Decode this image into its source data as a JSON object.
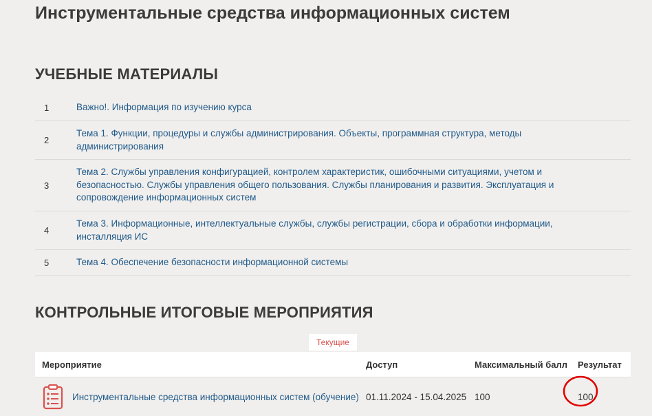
{
  "course": {
    "title": "Инструментальные средства информационных систем"
  },
  "materials": {
    "heading": "УЧЕБНЫЕ МАТЕРИАЛЫ",
    "items": [
      {
        "num": "1",
        "label": "Важно!. Информация по изучению курса"
      },
      {
        "num": "2",
        "label": "Тема 1. Функции, процедуры и службы администрирования. Объекты, программная структура, методы администрирования"
      },
      {
        "num": "3",
        "label": "Тема 2. Службы управления конфигурацией, контролем характеристик, ошибочными ситуациями, учетом и безопасностью. Службы управления общего пользования. Службы планирования и развития. Эксплуатация и сопровождение информационных систем"
      },
      {
        "num": "4",
        "label": "Тема 3. Информационные, интеллектуальные службы, службы регистрации, сбора и обработки информации, инсталляция ИС"
      },
      {
        "num": "5",
        "label": "Тема 4. Обеспечение безопасности информационной системы"
      }
    ]
  },
  "events": {
    "heading": "КОНТРОЛЬНЫЕ ИТОГОВЫЕ МЕРОПРИЯТИЯ",
    "tab_current": "Текущие",
    "columns": {
      "event": "Мероприятие",
      "access": "Доступ",
      "max_score": "Максимальный балл",
      "result": "Результат"
    },
    "rows": [
      {
        "icon": "clipboard-list-icon",
        "title": "Инструментальные средства информационных систем (обучение)",
        "access": "01.11.2024 - 15.04.2025",
        "max_score": "100",
        "result": "100"
      }
    ]
  },
  "colors": {
    "background": "#f1efed",
    "link": "#1f5a8a",
    "accent_red": "#d9534f",
    "annotation_circle": "#e00000"
  }
}
